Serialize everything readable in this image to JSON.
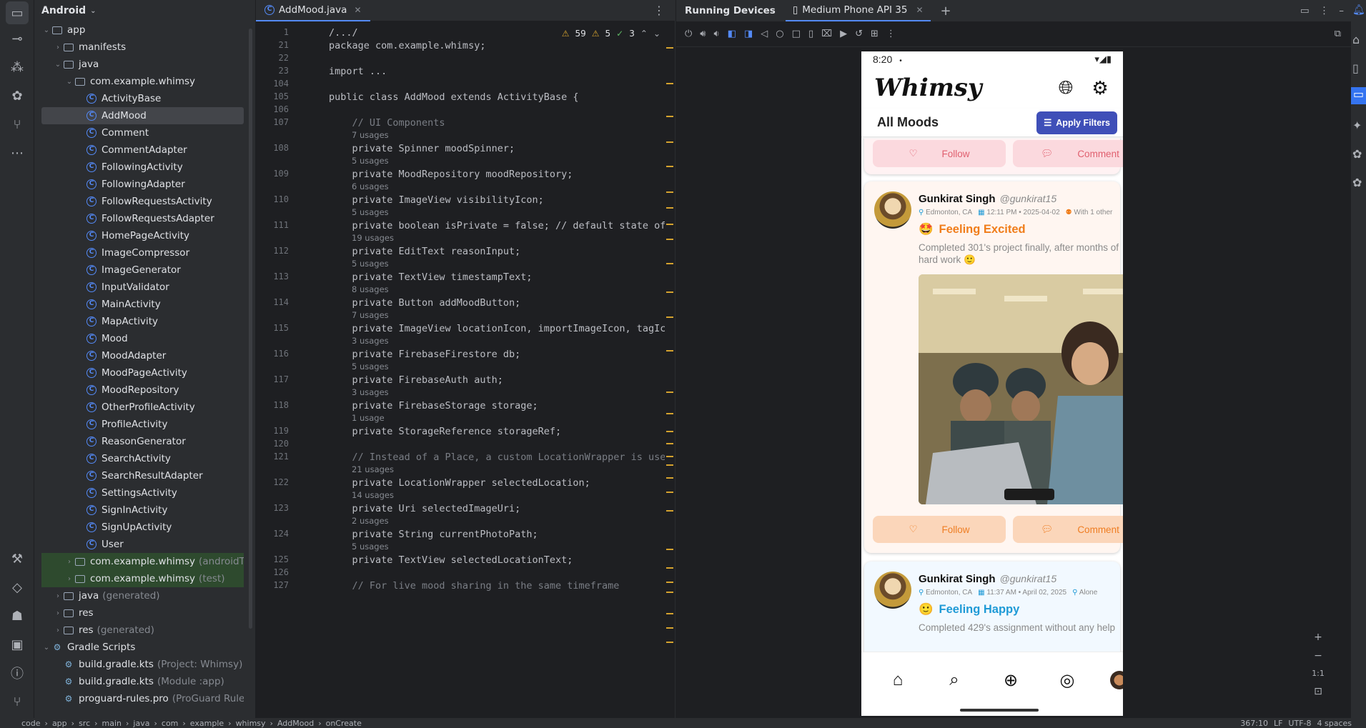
{
  "project_panel": {
    "view_label": "Android",
    "tree": [
      {
        "label": "app",
        "kind": "module",
        "depth": 0,
        "expanded": true
      },
      {
        "label": "manifests",
        "kind": "folder",
        "depth": 1,
        "expanded": false
      },
      {
        "label": "java",
        "kind": "folder",
        "depth": 1,
        "expanded": true
      },
      {
        "label": "com.example.whimsy",
        "kind": "package",
        "depth": 2,
        "expanded": true
      },
      {
        "label": "ActivityBase",
        "kind": "class",
        "depth": 3
      },
      {
        "label": "AddMood",
        "kind": "class",
        "depth": 3,
        "selected": true
      },
      {
        "label": "Comment",
        "kind": "class",
        "depth": 3
      },
      {
        "label": "CommentAdapter",
        "kind": "class",
        "depth": 3
      },
      {
        "label": "FollowingActivity",
        "kind": "class",
        "depth": 3
      },
      {
        "label": "FollowingAdapter",
        "kind": "class",
        "depth": 3
      },
      {
        "label": "FollowRequestsActivity",
        "kind": "class",
        "depth": 3
      },
      {
        "label": "FollowRequestsAdapter",
        "kind": "class",
        "depth": 3
      },
      {
        "label": "HomePageActivity",
        "kind": "class",
        "depth": 3
      },
      {
        "label": "ImageCompressor",
        "kind": "class",
        "depth": 3
      },
      {
        "label": "ImageGenerator",
        "kind": "class",
        "depth": 3
      },
      {
        "label": "InputValidator",
        "kind": "class",
        "depth": 3
      },
      {
        "label": "MainActivity",
        "kind": "class",
        "depth": 3
      },
      {
        "label": "MapActivity",
        "kind": "class",
        "depth": 3
      },
      {
        "label": "Mood",
        "kind": "class",
        "depth": 3
      },
      {
        "label": "MoodAdapter",
        "kind": "class",
        "depth": 3
      },
      {
        "label": "MoodPageActivity",
        "kind": "class",
        "depth": 3
      },
      {
        "label": "MoodRepository",
        "kind": "class",
        "depth": 3
      },
      {
        "label": "OtherProfileActivity",
        "kind": "class",
        "depth": 3
      },
      {
        "label": "ProfileActivity",
        "kind": "class",
        "depth": 3
      },
      {
        "label": "ReasonGenerator",
        "kind": "class",
        "depth": 3
      },
      {
        "label": "SearchActivity",
        "kind": "class",
        "depth": 3
      },
      {
        "label": "SearchResultAdapter",
        "kind": "class",
        "depth": 3
      },
      {
        "label": "SettingsActivity",
        "kind": "class",
        "depth": 3
      },
      {
        "label": "SignInActivity",
        "kind": "class",
        "depth": 3
      },
      {
        "label": "SignUpActivity",
        "kind": "class",
        "depth": 3
      },
      {
        "label": "User",
        "kind": "class",
        "depth": 3
      },
      {
        "label": "com.example.whimsy",
        "suffix": "(androidTest)",
        "kind": "package",
        "depth": 2,
        "expanded": false,
        "test": true
      },
      {
        "label": "com.example.whimsy",
        "suffix": "(test)",
        "kind": "package",
        "depth": 2,
        "expanded": false,
        "test": true
      },
      {
        "label": "java",
        "suffix": "(generated)",
        "kind": "folder",
        "depth": 1,
        "expanded": false
      },
      {
        "label": "res",
        "kind": "folder",
        "depth": 1,
        "expanded": false
      },
      {
        "label": "res",
        "suffix": "(generated)",
        "kind": "folder",
        "depth": 1,
        "expanded": false
      },
      {
        "label": "Gradle Scripts",
        "kind": "gradle",
        "depth": 0,
        "expanded": true
      },
      {
        "label": "build.gradle.kts",
        "suffix": "(Project: Whimsy)",
        "kind": "gradlefile",
        "depth": 1
      },
      {
        "label": "build.gradle.kts",
        "suffix": "(Module :app)",
        "kind": "gradlefile",
        "depth": 1
      },
      {
        "label": "proguard-rules.pro",
        "suffix": "(ProGuard Rules",
        "kind": "gradlefile",
        "depth": 1
      }
    ]
  },
  "editor": {
    "tab_label": "AddMood.java",
    "inspections": {
      "warnings": "59",
      "weak_warnings": "5",
      "ok": "3"
    },
    "lines": [
      {
        "n": "1",
        "code": "/.../",
        "kind": "fold"
      },
      {
        "n": "21",
        "code": "package com.example.whimsy;"
      },
      {
        "n": "22",
        "code": ""
      },
      {
        "n": "23",
        "code": "import ...",
        "kind": "fold"
      },
      {
        "n": "104",
        "code": ""
      },
      {
        "n": "105",
        "code": "public class AddMood extends ActivityBase {"
      },
      {
        "n": "106",
        "code": ""
      },
      {
        "n": "107",
        "code": "    // UI Components",
        "kind": "comment",
        "hint": "7 usages"
      },
      {
        "n": "108",
        "code": "    private Spinner moodSpinner;",
        "hint": "5 usages"
      },
      {
        "n": "109",
        "code": "    private MoodRepository moodRepository;",
        "hint": "6 usages"
      },
      {
        "n": "110",
        "code": "    private ImageView visibilityIcon;",
        "hint": "5 usages"
      },
      {
        "n": "111",
        "code": "    private boolean isPrivate = false; // default state of a m",
        "hint": "19 usages"
      },
      {
        "n": "112",
        "code": "    private EditText reasonInput;",
        "hint": "5 usages"
      },
      {
        "n": "113",
        "code": "    private TextView timestampText;",
        "hint": "8 usages"
      },
      {
        "n": "114",
        "code": "    private Button addMoodButton;",
        "hint": "7 usages"
      },
      {
        "n": "115",
        "code": "    private ImageView locationIcon, importImageIcon, tagIcon, ",
        "hint": "3 usages"
      },
      {
        "n": "116",
        "code": "    private FirebaseFirestore db;",
        "hint": "5 usages"
      },
      {
        "n": "117",
        "code": "    private FirebaseAuth auth;",
        "hint": "3 usages"
      },
      {
        "n": "118",
        "code": "    private FirebaseStorage storage;",
        "hint": "1 usage"
      },
      {
        "n": "119",
        "code": "    private StorageReference storageRef;"
      },
      {
        "n": "120",
        "code": ""
      },
      {
        "n": "121",
        "code": "    // Instead of a Place, a custom LocationWrapper is used to",
        "kind": "comment",
        "hint": "21 usages"
      },
      {
        "n": "122",
        "code": "    private LocationWrapper selectedLocation;",
        "hint": "14 usages"
      },
      {
        "n": "123",
        "code": "    private Uri selectedImageUri;",
        "hint": "2 usages"
      },
      {
        "n": "124",
        "code": "    private String currentPhotoPath;",
        "hint": "5 usages"
      },
      {
        "n": "125",
        "code": "    private TextView selectedLocationText;"
      },
      {
        "n": "126",
        "code": ""
      },
      {
        "n": "127",
        "code": "    // For live mood sharing in the same timeframe",
        "kind": "comment"
      }
    ]
  },
  "running_devices": {
    "title": "Running Devices",
    "device_tab": "Medium Phone API 35",
    "zoom_label": "1:1"
  },
  "phone": {
    "time": "8:20",
    "app_name": "Whimsy",
    "section_title": "All Moods",
    "filter_button": "Apply Filters",
    "follow_label": "Follow",
    "comment_label": "Comment",
    "posts": [
      {
        "name": "Gunkirat Singh",
        "handle": "@gunkirat15",
        "location": "Edmonton, CA",
        "datetime": "12:11 PM • 2025-04-02",
        "social": "With 1 other",
        "mood": "Feeling Excited",
        "mood_color": "#f07d1a",
        "mood_emoji": "🤩",
        "description": "Completed 301's project finally, after months of hard work 🙂",
        "bg": "#fff6f1",
        "btn_bg": "#fbd6ba",
        "btn_fg": "#ef7d22"
      },
      {
        "name": "Gunkirat Singh",
        "handle": "@gunkirat15",
        "location": "Edmonton, CA",
        "datetime": "11:37 AM • April 02, 2025",
        "social": "Alone",
        "mood": "Feeling Happy",
        "mood_color": "#1f9ad6",
        "mood_emoji": "🙂",
        "description": "Completed 429's assignment without any help",
        "bg": "#f2f9ff"
      }
    ],
    "prev_card": {
      "bg": "#fff2f3",
      "btn_bg": "#fbd9de",
      "btn_fg": "#e0606f"
    }
  },
  "status_bar": {
    "breadcrumb": [
      "code",
      "app",
      "src",
      "main",
      "java",
      "com",
      "example",
      "whimsy",
      "AddMood",
      "onCreate"
    ],
    "position": "367:10",
    "line_ending": "LF",
    "encoding": "UTF-8",
    "indent": "4 spaces"
  }
}
